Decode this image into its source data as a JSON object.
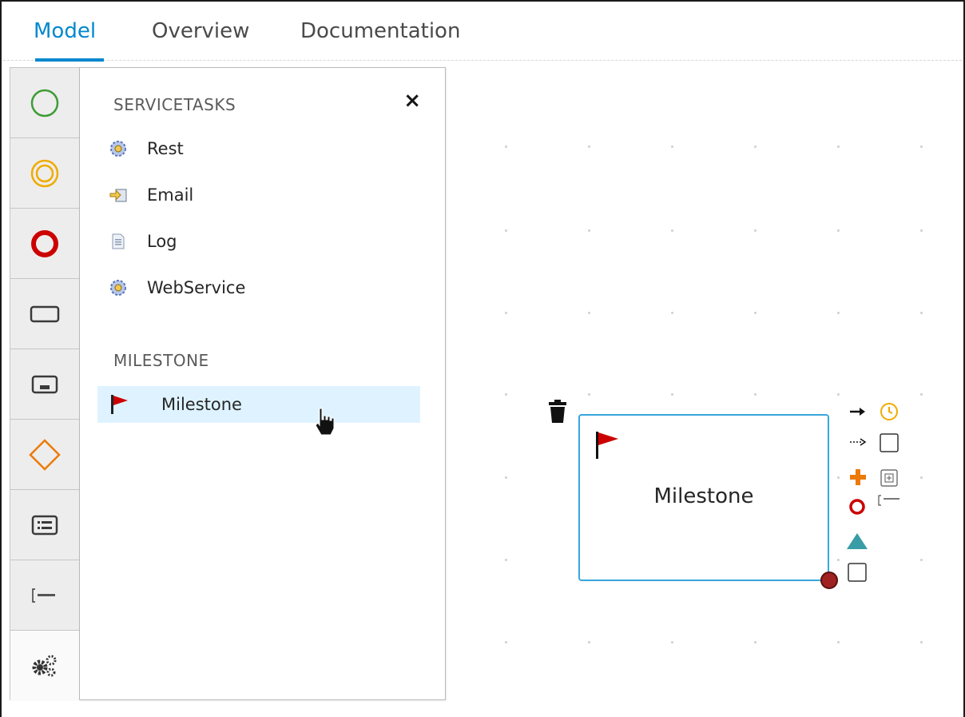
{
  "tabs": [
    {
      "label": "Model",
      "active": true
    },
    {
      "label": "Overview",
      "active": false
    },
    {
      "label": "Documentation",
      "active": false
    }
  ],
  "palette": {
    "items": [
      {
        "name": "start-event",
        "icon": "green-circle-icon"
      },
      {
        "name": "intermediate-event",
        "icon": "orange-double-circle-icon"
      },
      {
        "name": "end-event",
        "icon": "red-thick-circle-icon"
      },
      {
        "name": "task",
        "icon": "rectangle-icon"
      },
      {
        "name": "subprocess",
        "icon": "rectangle-bar-icon"
      },
      {
        "name": "gateway",
        "icon": "orange-diamond-icon"
      },
      {
        "name": "container",
        "icon": "list-box-icon"
      },
      {
        "name": "text-annotation",
        "icon": "annotation-icon"
      },
      {
        "name": "custom-tasks",
        "icon": "gears-icon"
      }
    ]
  },
  "flyout": {
    "close_label": "×",
    "sections": [
      {
        "title": "SERVICETASKS",
        "items": [
          {
            "label": "Rest",
            "icon": "gear-service-icon"
          },
          {
            "label": "Email",
            "icon": "email-arrow-icon"
          },
          {
            "label": "Log",
            "icon": "document-icon"
          },
          {
            "label": "WebService",
            "icon": "gear-service-icon"
          }
        ]
      },
      {
        "title": "MILESTONE",
        "items": [
          {
            "label": "Milestone",
            "icon": "red-flag-icon",
            "selected": true
          }
        ]
      }
    ]
  },
  "canvas": {
    "node": {
      "label": "Milestone",
      "icon": "red-flag-icon",
      "border_color": "#39a5dc"
    },
    "toolbox": [
      "arrow-right-icon",
      "clock-icon",
      "dashed-arrow-icon",
      "square-icon",
      "plus-icon",
      "plus-box-icon",
      "red-circle-icon",
      "annotation-icon",
      "teal-triangle-icon",
      "square-icon"
    ]
  },
  "colors": {
    "accent": "#0088ce",
    "selected_bg": "#def3ff",
    "node_border": "#39a5dc",
    "flag": "#cc0000",
    "start": "#3f9c35",
    "intermediate": "#f0ab00",
    "end": "#cc0000",
    "gateway": "#ec7a08",
    "teal": "#3a9ca6"
  }
}
